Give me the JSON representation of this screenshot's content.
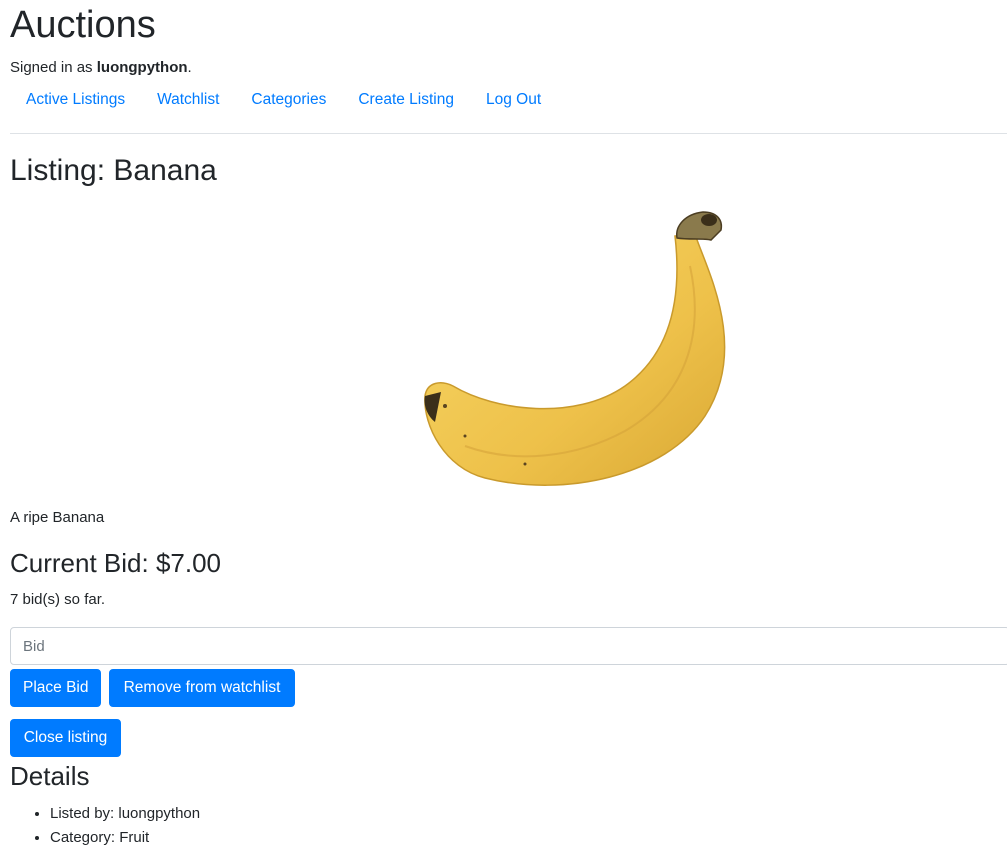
{
  "header": {
    "site_title": "Auctions",
    "signed_in_prefix": "Signed in as ",
    "username": "luongpython",
    "signed_in_suffix": "."
  },
  "nav": {
    "items": [
      {
        "label": "Active Listings"
      },
      {
        "label": "Watchlist"
      },
      {
        "label": "Categories"
      },
      {
        "label": "Create Listing"
      },
      {
        "label": "Log Out"
      }
    ]
  },
  "listing": {
    "title": "Listing: Banana",
    "image_subject": "banana",
    "description": "A ripe Banana",
    "current_bid": "Current Bid: $7.00",
    "bid_count": "7 bid(s) so far."
  },
  "bid_form": {
    "placeholder": "Bid",
    "place_bid_label": "Place Bid",
    "watchlist_label": "Remove from watchlist",
    "close_label": "Close listing"
  },
  "details": {
    "title": "Details",
    "items": [
      {
        "text": "Listed by: luongpython"
      },
      {
        "text": "Category: Fruit"
      }
    ]
  },
  "colors": {
    "link": "#007bff",
    "button_bg": "#007bff",
    "text": "#212529",
    "banana": "#f2c94c"
  }
}
